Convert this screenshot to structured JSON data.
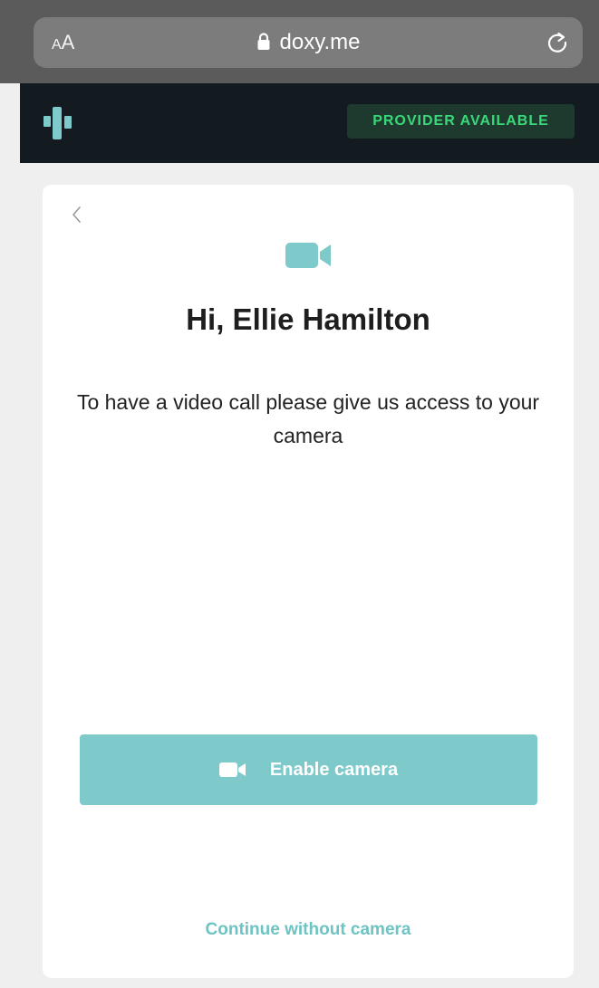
{
  "browser": {
    "text_size_label_small": "A",
    "text_size_label_large": "A",
    "url": "doxy.me"
  },
  "header": {
    "status_badge": "PROVIDER AVAILABLE"
  },
  "card": {
    "greeting": "Hi, Ellie Hamilton",
    "description": "To have a video call please give us access to your camera",
    "enable_button_label": "Enable camera",
    "continue_link": "Continue without camera"
  },
  "colors": {
    "accent": "#7ec9c9",
    "header_bg": "#131b21",
    "status_text": "#39d97a",
    "status_bg": "#1e3a2f"
  },
  "icons": {
    "logo": "doxy-logo-icon",
    "lock": "lock-icon",
    "reload": "reload-icon",
    "back": "chevron-left-icon",
    "camera": "video-camera-icon"
  }
}
